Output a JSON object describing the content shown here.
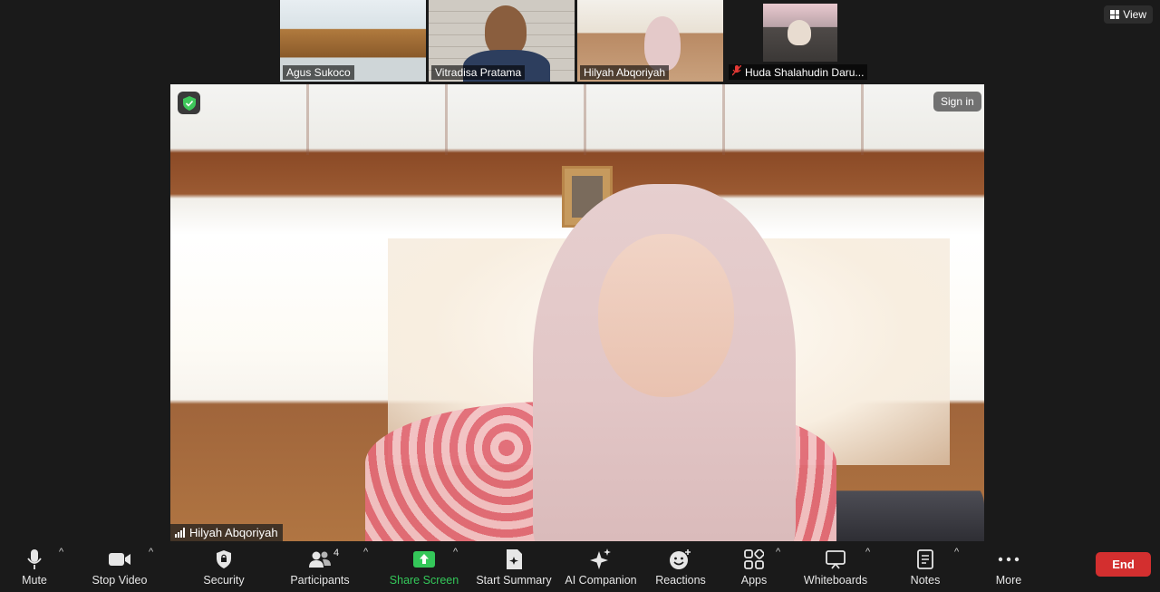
{
  "participants": [
    {
      "name": "Agus Sukoco",
      "muted": false
    },
    {
      "name": "Vitradisa Pratama",
      "muted": false
    },
    {
      "name": "Hilyah Abqoriyah",
      "muted": false
    },
    {
      "name": "Huda Shalahudin Daru...",
      "muted": true
    }
  ],
  "view_button": {
    "label": "View",
    "icon": "grid-icon"
  },
  "main": {
    "speaker_name": "Hilyah Abqoriyah",
    "sign_in_label": "Sign in",
    "security_badge_color": "#3ec85a"
  },
  "toolbar": {
    "mute": {
      "label": "Mute",
      "icon": "microphone-icon"
    },
    "stop_video": {
      "label": "Stop Video",
      "icon": "video-camera-icon"
    },
    "security": {
      "label": "Security",
      "icon": "shield-icon"
    },
    "participants": {
      "label": "Participants",
      "count": "4",
      "icon": "people-icon"
    },
    "share_screen": {
      "label": "Share Screen",
      "icon": "share-screen-icon",
      "color": "#34c759"
    },
    "start_summary": {
      "label": "Start Summary",
      "icon": "summary-icon"
    },
    "ai_companion": {
      "label": "AI Companion",
      "icon": "sparkle-icon"
    },
    "reactions": {
      "label": "Reactions",
      "icon": "smiley-icon"
    },
    "apps": {
      "label": "Apps",
      "icon": "apps-icon"
    },
    "whiteboards": {
      "label": "Whiteboards",
      "icon": "whiteboard-icon"
    },
    "notes": {
      "label": "Notes",
      "icon": "notes-icon"
    },
    "more": {
      "label": "More",
      "icon": "more-icon"
    },
    "end": {
      "label": "End",
      "color": "#d32f2f"
    }
  }
}
